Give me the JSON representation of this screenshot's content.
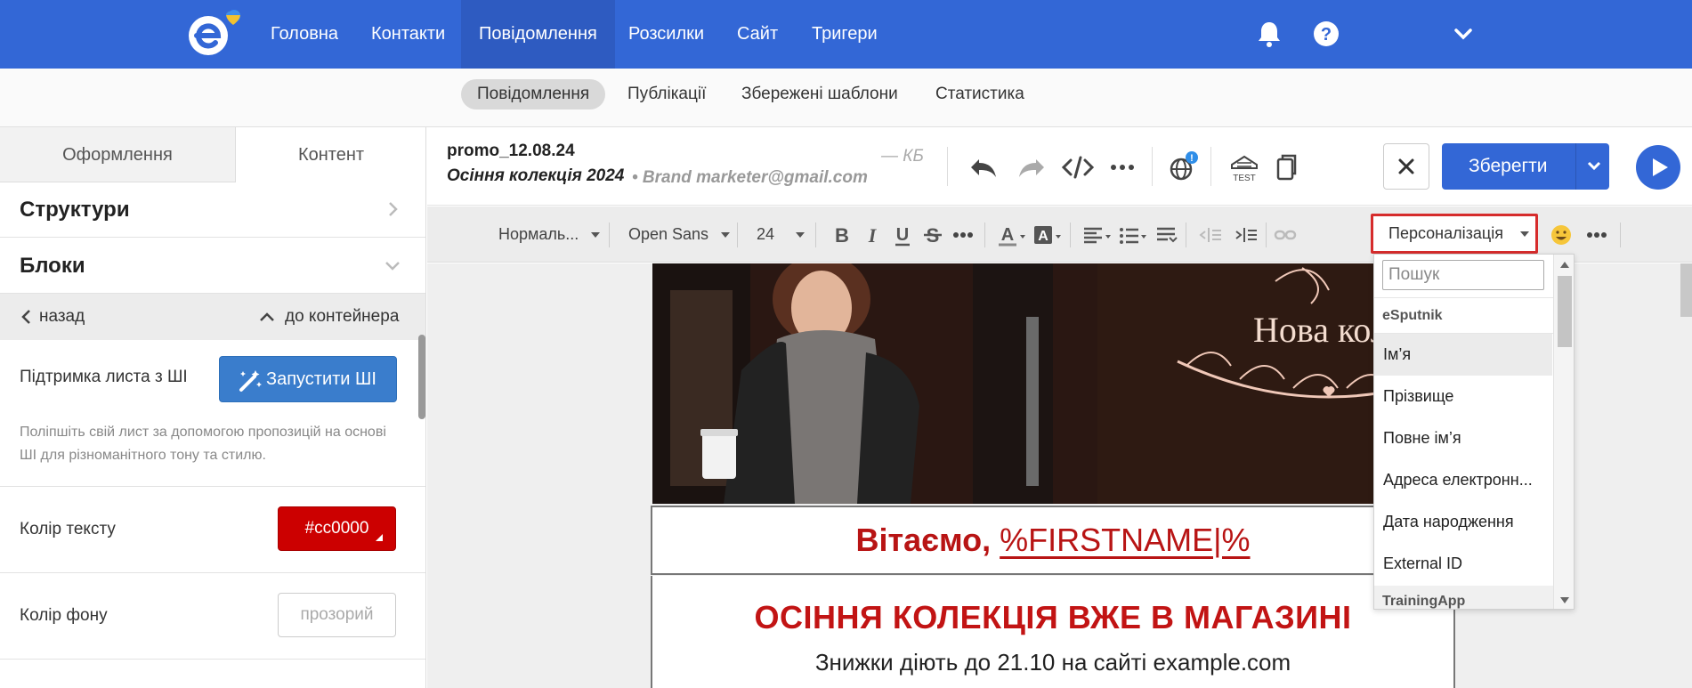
{
  "topnav": {
    "items": [
      {
        "label": "Головна"
      },
      {
        "label": "Контакти"
      },
      {
        "label": "Повідомлення"
      },
      {
        "label": "Розсилки"
      },
      {
        "label": "Сайт"
      },
      {
        "label": "Тригери"
      }
    ],
    "active_index": 2,
    "icons": [
      "logo-icon",
      "bell-icon",
      "help-icon",
      "chevron-down-icon"
    ]
  },
  "subnav": {
    "items": [
      {
        "label": "Повідомлення"
      },
      {
        "label": "Публікації"
      },
      {
        "label": "Збережені шаблони"
      },
      {
        "label": "Статистика"
      }
    ],
    "active_index": 0
  },
  "sidebar": {
    "tabs": [
      {
        "label": "Оформлення"
      },
      {
        "label": "Контент"
      }
    ],
    "active_tab": 1,
    "sections": [
      {
        "label": "Структури"
      },
      {
        "label": "Блоки"
      }
    ],
    "back_label": "назад",
    "container_label": "до контейнера",
    "ai_support_label": "Підтримка листа з ШІ",
    "ai_button_label": "Запустити ШІ",
    "ai_help": "Поліпшіть свій лист за допомогою пропозицій на основі ШІ для різноманітного тону та стилю.",
    "text_color_label": "Колір тексту",
    "text_color_value": "#cc0000",
    "bg_color_label": "Колір фону",
    "bg_color_value": "прозорий"
  },
  "editor": {
    "message_name": "promo_12.08.24",
    "subject": "Осіння колекція 2024",
    "sender": "• Brand marketer@gmail.com",
    "size_hint": "— КБ",
    "test_label": "TEST",
    "save_label": "Зберегти"
  },
  "format_bar": {
    "style": "Нормаль...",
    "font": "Open Sans",
    "size": "24",
    "personalization_label": "Персоналізація"
  },
  "canvas": {
    "hero_text": "Нова колекції",
    "greeting_prefix": "Вітаємо,",
    "greeting_var": "%FIRSTNAME|%",
    "promo_title": "ОСІННЯ КОЛЕКЦІЯ ВЖЕ В МАГАЗИНІ",
    "promo_sub": "Знижки діють до 21.10 на сайті example.com"
  },
  "dropdown": {
    "search_placeholder": "Пошук",
    "group1": "eSputnik",
    "items": [
      {
        "label": "Ім’я"
      },
      {
        "label": "Прізвище"
      },
      {
        "label": "Повне ім’я"
      },
      {
        "label": "Адреса електронн..."
      },
      {
        "label": "Дата народження"
      },
      {
        "label": "External ID"
      }
    ],
    "group2": "TrainingApp"
  },
  "colors": {
    "brand_blue": "#3367d6",
    "accent_red": "#cc0000",
    "highlight_border": "#d62c2c"
  }
}
